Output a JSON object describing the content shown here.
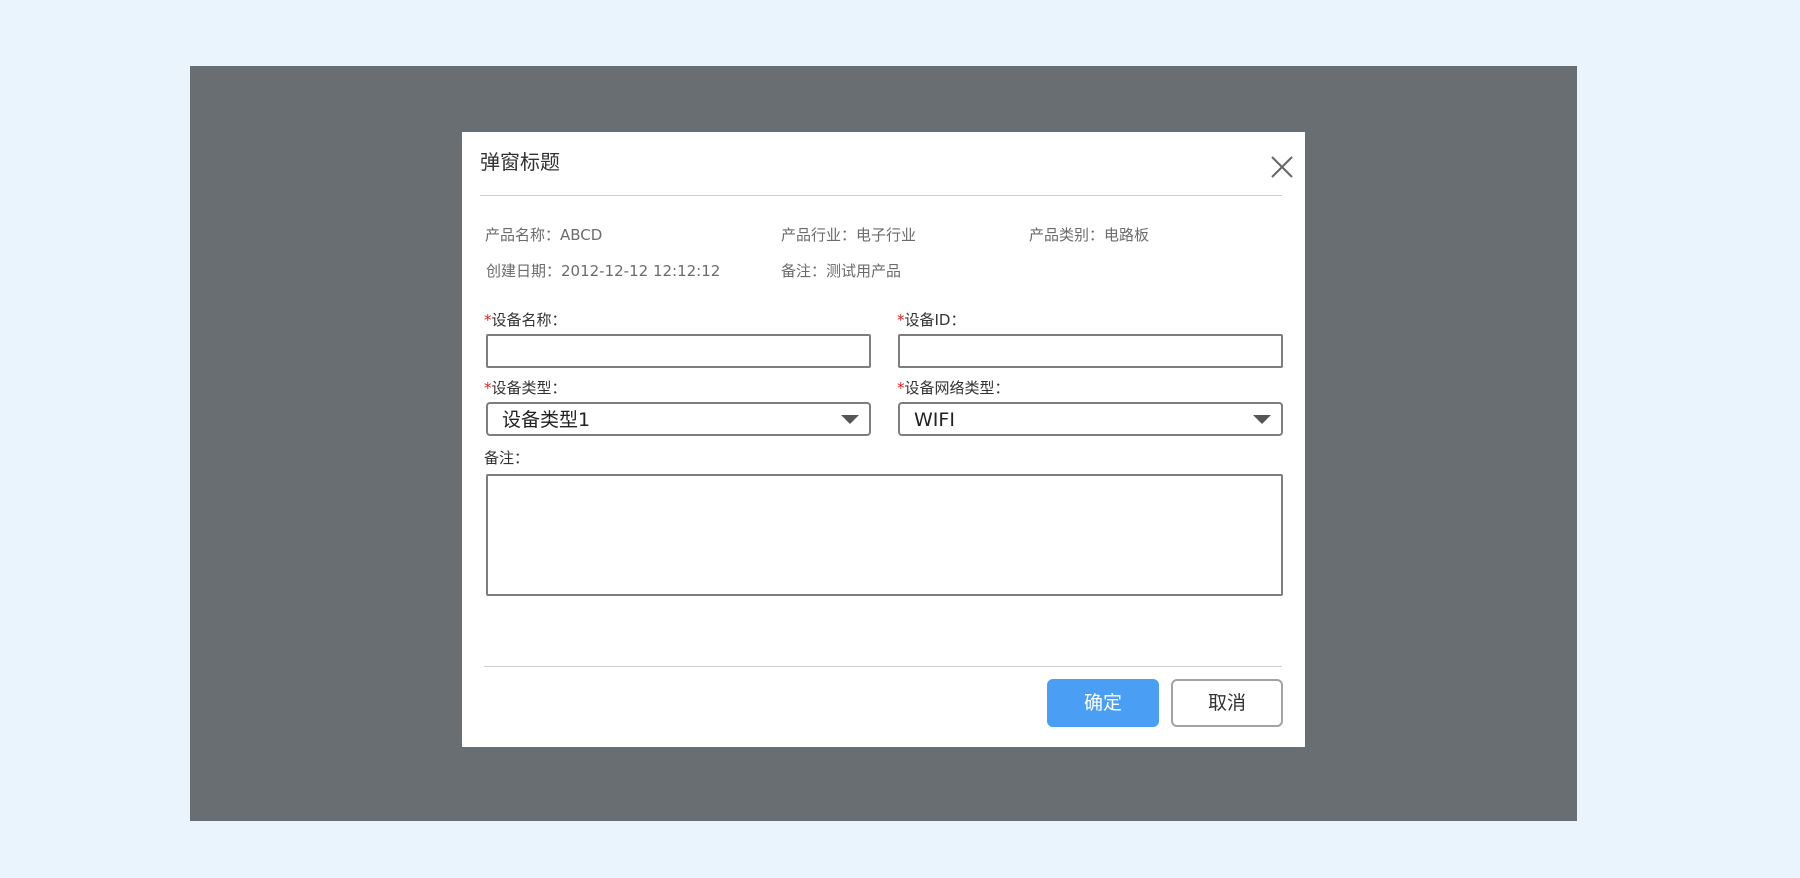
{
  "dialog": {
    "title": "弹窗标题",
    "close_icon": "close-icon"
  },
  "info": {
    "product_name": "产品名称：ABCD",
    "product_industry": "产品行业：电子行业",
    "product_category": "产品类别：电路板",
    "created_date": "创建日期：2012-12-12 12:12:12",
    "remark": "备注：测试用产品"
  },
  "form": {
    "required_mark": "*",
    "device_name": {
      "label": "设备名称：",
      "value": "",
      "placeholder": ""
    },
    "device_id": {
      "label": "设备ID：",
      "value": "",
      "placeholder": ""
    },
    "device_type": {
      "label": "设备类型：",
      "selected": "设备类型1"
    },
    "network_type": {
      "label": "设备网络类型：",
      "selected": "WIFI"
    },
    "remark": {
      "label": "备注：",
      "value": ""
    }
  },
  "footer": {
    "confirm_label": "确定",
    "cancel_label": "取消"
  },
  "colors": {
    "page_background": "#e9f4fd",
    "overlay": "#696e72",
    "primary": "#4a9ff5",
    "required": "#e02020"
  }
}
